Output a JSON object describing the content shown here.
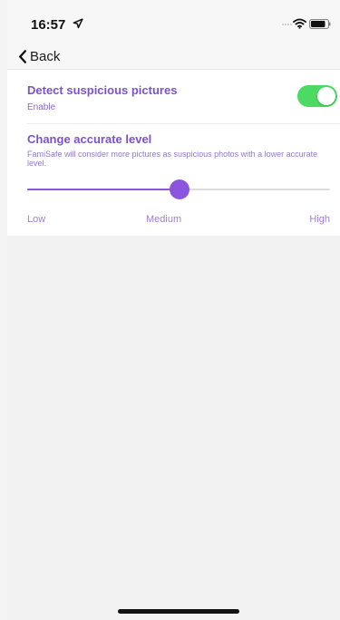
{
  "status_bar": {
    "time": "16:57",
    "location_icon": "location-arrow-icon",
    "signal_icon": "signal-dots-icon",
    "wifi_icon": "wifi-icon",
    "battery_icon": "battery-icon"
  },
  "nav": {
    "back_label": "Back",
    "back_icon": "chevron-left-icon"
  },
  "settings": {
    "detect_title": "Detect suspicious pictures",
    "enable_label": "Enable",
    "toggle_on": true,
    "accuracy_title": "Change accurate level",
    "accuracy_description": "FamiSafe will consider more pictures as suspicious photos with a lower accurate level.",
    "slider_value": 0.5,
    "levels": [
      "Low",
      "Medium",
      "High"
    ],
    "selected_level": "Medium"
  },
  "colors": {
    "accent_purple": "#7a53c8",
    "slider_purple": "#8c55e0",
    "toggle_green": "#4cd964"
  }
}
